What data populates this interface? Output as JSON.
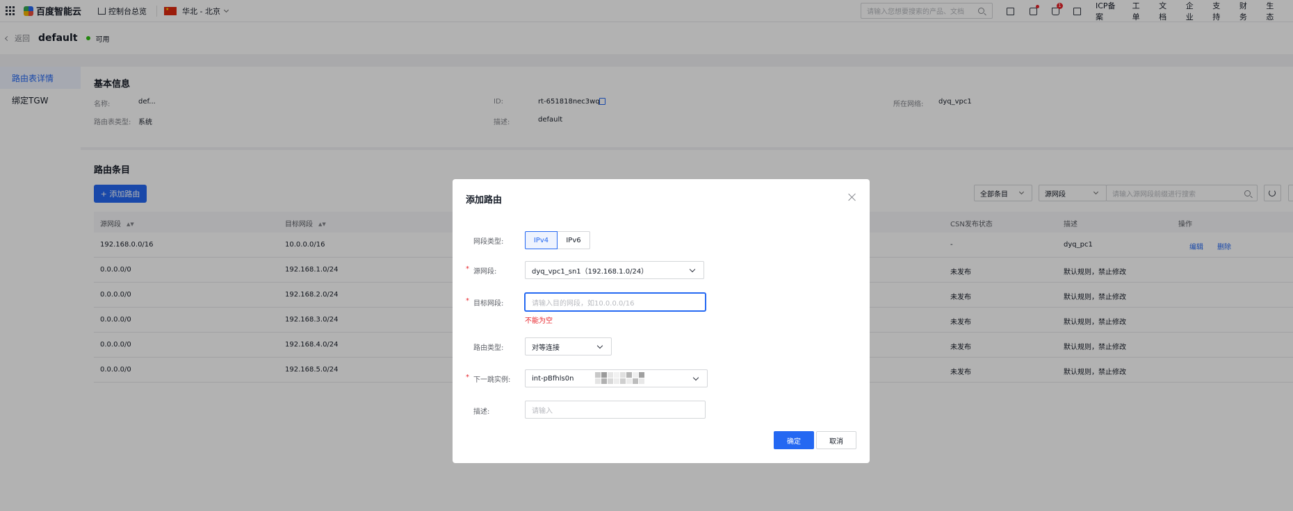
{
  "topbar": {
    "brand": "百度智能云",
    "console": "控制台总览",
    "region": "华北 - 北京",
    "search_placeholder": "请输入您想要搜索的产品、文档",
    "cart_badge": "1",
    "nav": [
      "ICP备案",
      "工单",
      "文档",
      "企业",
      "支持",
      "财务",
      "生态"
    ]
  },
  "header": {
    "back": "返回",
    "title": "default",
    "status": "可用",
    "status_color": "#30bf13"
  },
  "sidebar": {
    "items": [
      {
        "label": "路由表详情",
        "active": true
      },
      {
        "label": "绑定TGW",
        "active": false
      }
    ]
  },
  "basic_info": {
    "title": "基本信息",
    "name_label": "名称:",
    "name_value": "def...",
    "id_label": "ID:",
    "id_value": "rt-651818nec3wq",
    "vpc_label": "所在网络:",
    "vpc_value": "dyq_vpc1",
    "type_label": "路由表类型:",
    "type_value": "系统",
    "desc_label": "描述:",
    "desc_value": "default"
  },
  "routes": {
    "title": "路由条目",
    "add_button": "+ 添加路由",
    "filter_all": "全部条目",
    "filter_field": "源网段",
    "search_placeholder": "请输入源网段前缀进行搜索",
    "columns": [
      "源网段",
      "目标网段",
      "CSN发布状态",
      "描述",
      "操作"
    ],
    "rows": [
      {
        "src": "192.168.0.0/16",
        "dst": "10.0.0.0/16",
        "csn": "-",
        "desc": "dyq_pc1",
        "edit": "编辑",
        "delete": "删除"
      },
      {
        "src": "0.0.0.0/0",
        "dst": "192.168.1.0/24",
        "csn": "未发布",
        "desc": "默认规则，禁止修改"
      },
      {
        "src": "0.0.0.0/0",
        "dst": "192.168.2.0/24",
        "csn": "未发布",
        "desc": "默认规则，禁止修改"
      },
      {
        "src": "0.0.0.0/0",
        "dst": "192.168.3.0/24",
        "csn": "未发布",
        "desc": "默认规则，禁止修改"
      },
      {
        "src": "0.0.0.0/0",
        "dst": "192.168.4.0/24",
        "csn": "未发布",
        "desc": "默认规则，禁止修改"
      },
      {
        "src": "0.0.0.0/0",
        "dst": "192.168.5.0/24",
        "csn": "未发布",
        "desc": "默认规则，禁止修改"
      }
    ]
  },
  "modal": {
    "title": "添加路由",
    "ip_type_label": "网段类型:",
    "ipv4": "IPv4",
    "ipv6": "IPv6",
    "src_label": "源网段:",
    "src_value": "dyq_vpc1_sn1（192.168.1.0/24）",
    "dst_label": "目标网段:",
    "dst_placeholder": "请输入目的网段，如10.0.0.0/16",
    "dst_error": "不能为空",
    "route_type_label": "路由类型:",
    "route_type_value": "对等连接",
    "next_hop_label": "下一跳实例:",
    "next_hop_value": "int-pBfhls0n",
    "desc_label": "描述:",
    "desc_placeholder": "请输入",
    "required_mark": "*",
    "ok": "确定",
    "cancel": "取消"
  }
}
